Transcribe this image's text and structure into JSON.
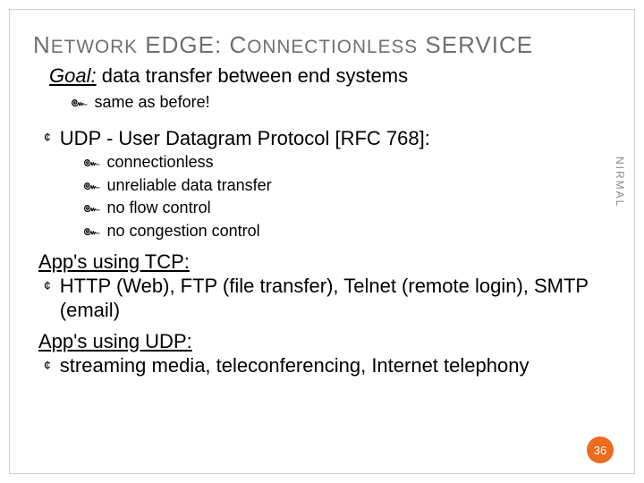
{
  "title": {
    "part1_caps": "N",
    "part1_sc": "ETWORK",
    "part2": " EDGE",
    "colon": ": ",
    "part3_caps": "C",
    "part3_sc": "ONNECTIONLESS",
    "part4": " SERVICE"
  },
  "goal": {
    "label": "Goal:",
    "text": " data transfer between end systems"
  },
  "goal_sub": "same as before!",
  "udp_heading": "UDP - User Datagram Protocol [RFC 768]:",
  "udp_items": {
    "i0": "connectionless",
    "i1": "unreliable data transfer",
    "i2": "no flow control",
    "i3": "no congestion control"
  },
  "apps_tcp_head": "App's using TCP:",
  "apps_tcp_item": "HTTP (Web), FTP (file transfer), Telnet (remote login), SMTP (email)",
  "apps_udp_head": "App's using UDP:",
  "apps_udp_item": "streaming media, teleconferencing, Internet telephony",
  "side_label": "NIRMAL",
  "page_number": "36",
  "bullets": {
    "circle": "¢",
    "swirl": "๛"
  }
}
